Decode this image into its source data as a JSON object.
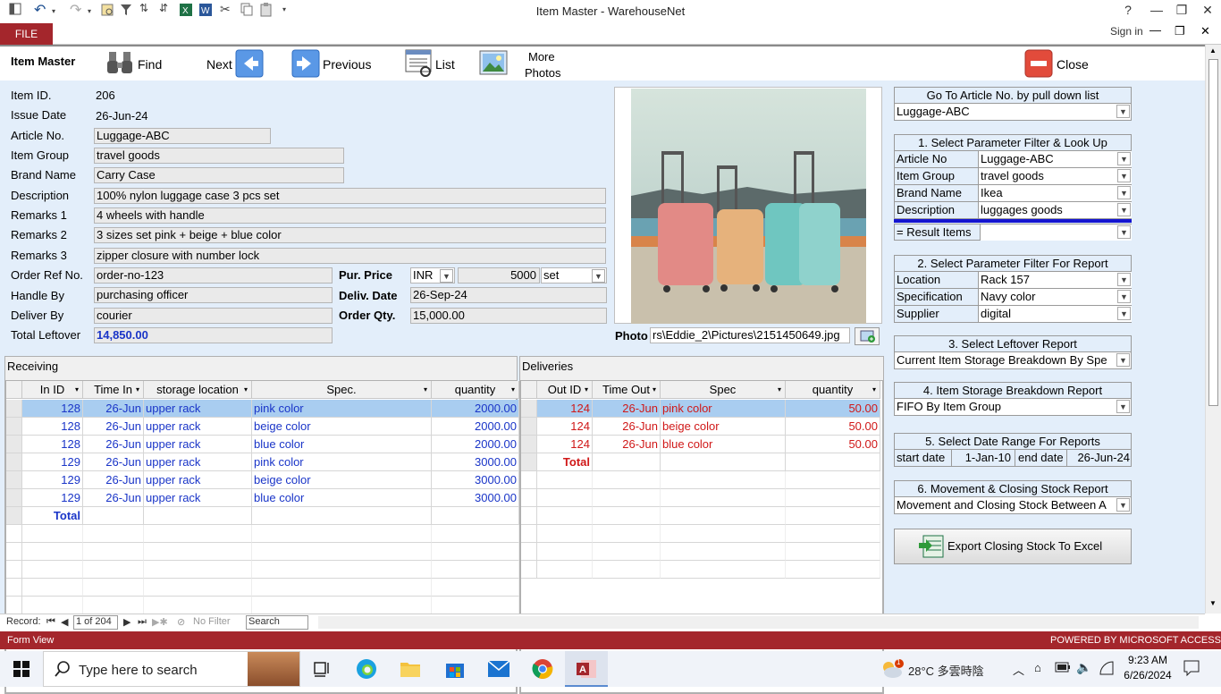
{
  "window": {
    "title": "Item Master - WarehouseNet",
    "help": "?",
    "signin": "Sign in"
  },
  "ribbon": {
    "file": "FILE"
  },
  "toolbar": {
    "form_name": "Item Master",
    "find": "Find",
    "next": "Next",
    "previous": "Previous",
    "list": "List",
    "more_photos_1": "More",
    "more_photos_2": "Photos",
    "close": "Close"
  },
  "item": {
    "labels": {
      "item_id": "Item ID.",
      "issue_date": "Issue Date",
      "article_no": "Article No.",
      "item_group": "Item Group",
      "brand_name": "Brand Name",
      "description": "Description",
      "remarks1": "Remarks 1",
      "remarks2": "Remarks 2",
      "remarks3": "Remarks 3",
      "order_ref": "Order Ref No.",
      "handle_by": "Handle By",
      "deliver_by": "Deliver By",
      "total_leftover": "Total Leftover",
      "pur_price": "Pur. Price",
      "deliv_date": "Deliv. Date",
      "order_qty": "Order Qty.",
      "photo": "Photo"
    },
    "item_id": "206",
    "issue_date": "26-Jun-24",
    "article_no": "Luggage-ABC",
    "item_group": "travel goods",
    "brand_name": "Carry Case",
    "description": "100% nylon luggage case 3 pcs set",
    "remarks1": "4 wheels with handle",
    "remarks2": "3 sizes set pink + beige + blue color",
    "remarks3": "zipper closure with number lock",
    "order_ref": "order-no-123",
    "handle_by": "purchasing officer",
    "deliver_by": "courier",
    "total_leftover": "14,850.00",
    "currency": "INR",
    "price": "5000",
    "unit": "set",
    "deliv_date": "26-Sep-24",
    "order_qty": "15,000.00",
    "photo_path": "rs\\Eddie_2\\Pictures\\2151450649.jpg"
  },
  "receiving": {
    "title": "Receiving",
    "headers": [
      "In ID",
      "Time In",
      "storage location",
      "Spec.",
      "quantity"
    ],
    "rows": [
      [
        "128",
        "26-Jun",
        "upper rack",
        "pink color",
        "2000.00"
      ],
      [
        "128",
        "26-Jun",
        "upper rack",
        "beige color",
        "2000.00"
      ],
      [
        "128",
        "26-Jun",
        "upper rack",
        "blue color",
        "2000.00"
      ],
      [
        "129",
        "26-Jun",
        "upper rack",
        "pink color",
        "3000.00"
      ],
      [
        "129",
        "26-Jun",
        "upper rack",
        "beige color",
        "3000.00"
      ],
      [
        "129",
        "26-Jun",
        "upper rack",
        "blue color",
        "3000.00"
      ]
    ],
    "total": "Total"
  },
  "deliveries": {
    "title": "Deliveries",
    "headers": [
      "Out ID",
      "Time Out",
      "Spec",
      "quantity"
    ],
    "rows": [
      [
        "124",
        "26-Jun",
        "pink color",
        "50.00"
      ],
      [
        "124",
        "26-Jun",
        "beige color",
        "50.00"
      ],
      [
        "124",
        "26-Jun",
        "blue color",
        "50.00"
      ]
    ],
    "total": "Total"
  },
  "right": {
    "goto_title": "Go To Article No. by pull down list",
    "goto_value": "Luggage-ABC",
    "p1_title": "1. Select Parameter Filter & Look Up",
    "p1_rows": [
      {
        "label": "Article No",
        "value": "Luggage-ABC"
      },
      {
        "label": "Item Group",
        "value": "travel goods"
      },
      {
        "label": "Brand Name",
        "value": "Ikea"
      },
      {
        "label": "Description",
        "value": "luggages goods"
      }
    ],
    "result_label": "= Result Items",
    "p2_title": "2. Select Parameter Filter For Report",
    "p2_rows": [
      {
        "label": "Location",
        "value": "Rack 157"
      },
      {
        "label": "Specification",
        "value": "Navy color"
      },
      {
        "label": "Supplier",
        "value": "digital"
      }
    ],
    "p3_title": "3. Select Leftover Report",
    "p3_value": "Current Item Storage Breakdown By Spe",
    "p4_title": "4. Item Storage Breakdown Report",
    "p4_value": "FIFO By Item Group",
    "p5_title": "5. Select Date Range For  Reports",
    "start_label": "start date",
    "start_value": "1-Jan-10",
    "end_label": "end date",
    "end_value": "26-Jun-24",
    "p6_title": "6. Movement & Closing Stock Report",
    "p6_value": "Movement and Closing Stock Between A",
    "export": "Export Closing Stock To Excel"
  },
  "nav": {
    "record_label": "Record:",
    "record_value": "1 of 204",
    "no_filter": "No Filter",
    "search": "Search"
  },
  "status": {
    "left": "Form View",
    "right": "POWERED BY MICROSOFT ACCESS"
  },
  "taskbar": {
    "search_placeholder": "Type here to search",
    "weather": "28°C  多雲時陰",
    "time": "9:23 AM",
    "date": "6/26/2024",
    "badge": "1"
  },
  "colors": {
    "access_red": "#a4262c",
    "form_bg": "#e3eefa",
    "recv_text": "#1a35c8",
    "deliv_text": "#d01818",
    "selected_row": "#a9cdf0"
  }
}
